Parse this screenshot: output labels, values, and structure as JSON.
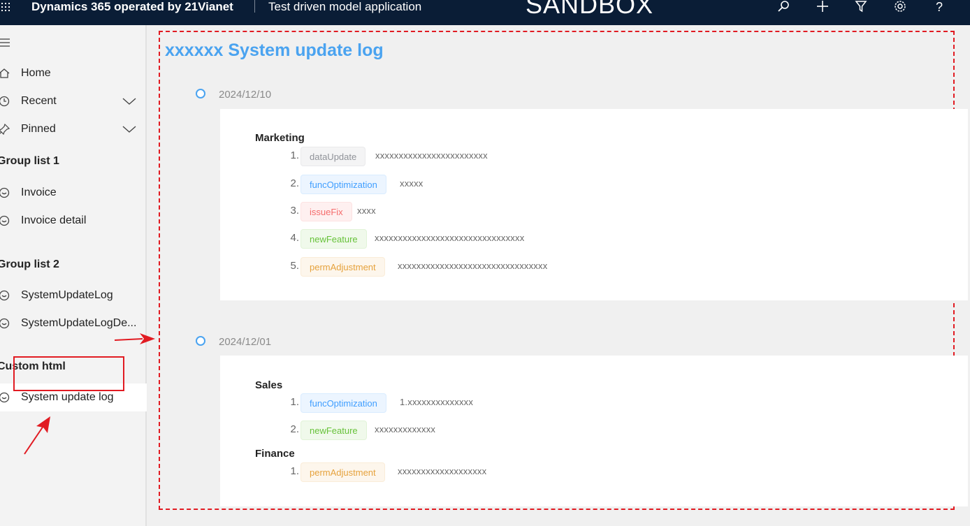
{
  "topbar": {
    "brand": "Dynamics 365 operated by 21Vianet",
    "app_name": "Test driven model application",
    "environment": "SANDBOX",
    "icons": [
      "waffle-icon",
      "search-icon",
      "plus-icon",
      "filter-icon",
      "gear-icon",
      "help-icon"
    ],
    "help_glyph": "?"
  },
  "sidebar": {
    "items": [
      {
        "label": "Home",
        "icon": "home-icon"
      },
      {
        "label": "Recent",
        "icon": "clock-icon",
        "expandable": true
      },
      {
        "label": "Pinned",
        "icon": "pin-icon",
        "expandable": true
      }
    ],
    "groups": [
      {
        "title": "Group list 1",
        "items": [
          {
            "label": "Invoice"
          },
          {
            "label": "Invoice detail"
          }
        ]
      },
      {
        "title": "Group list 2",
        "items": [
          {
            "label": "SystemUpdateLog"
          },
          {
            "label": "SystemUpdateLogDe..."
          }
        ]
      },
      {
        "title": "Custom html",
        "items": [
          {
            "label": "System update log",
            "active": true
          }
        ]
      }
    ]
  },
  "main": {
    "title": "xxxxxx System update log",
    "entries": [
      {
        "date": "2024/12/10",
        "categories": [
          {
            "name": "Marketing",
            "items": [
              {
                "num": "1.",
                "tag": "dataUpdate",
                "tag_type": "gray",
                "text": "xxxxxxxxxxxxxxxxxxxxxxxx"
              },
              {
                "num": "2.",
                "tag": "funcOptimization",
                "tag_type": "blue",
                "text": "xxxxx"
              },
              {
                "num": "3.",
                "tag": "issueFix",
                "tag_type": "red",
                "text": "xxxx"
              },
              {
                "num": "4.",
                "tag": "newFeature",
                "tag_type": "green",
                "text": "xxxxxxxxxxxxxxxxxxxxxxxxxxxxxxxx"
              },
              {
                "num": "5.",
                "tag": "permAdjustment",
                "tag_type": "orange",
                "text": "xxxxxxxxxxxxxxxxxxxxxxxxxxxxxxxx"
              }
            ]
          }
        ]
      },
      {
        "date": "2024/12/01",
        "categories": [
          {
            "name": "Sales",
            "items": [
              {
                "num": "1.",
                "tag": "funcOptimization",
                "tag_type": "blue",
                "text": "1.xxxxxxxxxxxxxx"
              },
              {
                "num": "2.",
                "tag": "newFeature",
                "tag_type": "green",
                "text": "xxxxxxxxxxxxx"
              }
            ]
          },
          {
            "name": "Finance",
            "items": [
              {
                "num": "1.",
                "tag": "permAdjustment",
                "tag_type": "orange",
                "text": "xxxxxxxxxxxxxxxxxxx"
              }
            ]
          }
        ]
      }
    ]
  },
  "colors": {
    "topbar_bg": "#0a1d36",
    "title": "#4aa3f0",
    "annotation_red": "#e11b22"
  }
}
